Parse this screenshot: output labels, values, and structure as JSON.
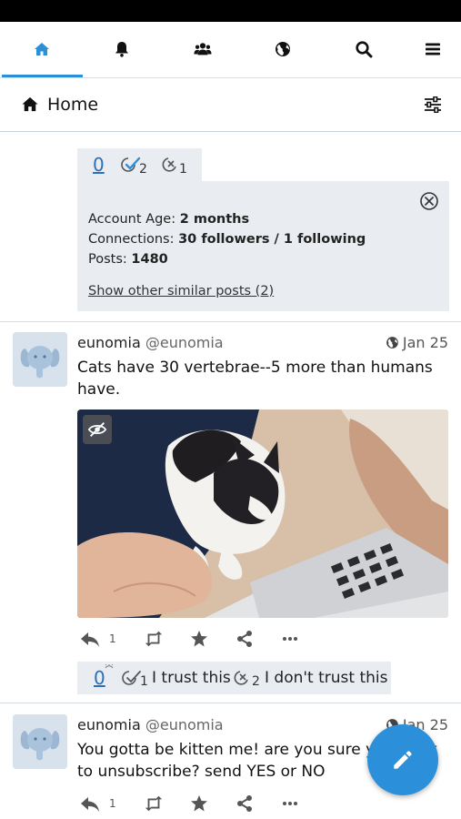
{
  "nav": {
    "tabs": [
      {
        "icon": "home-icon",
        "active": true
      },
      {
        "icon": "bell-icon"
      },
      {
        "icon": "users-icon"
      },
      {
        "icon": "globe-icon"
      },
      {
        "icon": "search-icon"
      },
      {
        "icon": "menu-icon"
      }
    ],
    "accent": "#2b90d9"
  },
  "header": {
    "title": "Home",
    "icon": "home-icon",
    "filter_icon": "sliders-icon"
  },
  "prev_post": {
    "trust": {
      "zero": "0",
      "trust_count": "2",
      "distrust_count": "1"
    },
    "info": {
      "account_age_label": "Account Age:",
      "account_age": "2 months",
      "connections_label": "Connections:",
      "connections": "30 followers / 1 following",
      "posts_label": "Posts:",
      "posts": "1480",
      "similar_link": "Show other similar posts (2)"
    }
  },
  "posts": [
    {
      "display_name": "eunomia",
      "handle": "@eunomia",
      "date": "Jan 25",
      "content": "Cats have 30 vertebrae--5 more than humans have.",
      "reply_count": "1",
      "trust": {
        "zero": "0",
        "trust_count": "1",
        "trust_label": "I trust this",
        "distrust_count": "2",
        "distrust_label": "I don't trust this"
      }
    },
    {
      "display_name": "eunomia",
      "handle": "@eunomia",
      "date": "Jan 25",
      "content": "You gotta be kitten me! are you sure you want to unsubscribe? send YES or NO",
      "reply_count": "1"
    }
  ]
}
